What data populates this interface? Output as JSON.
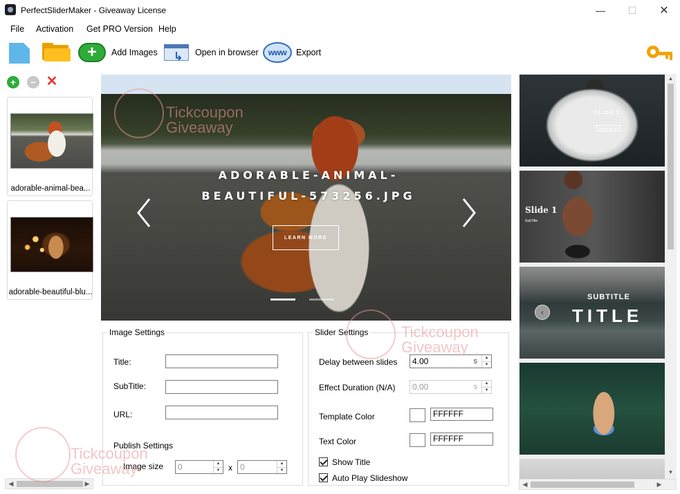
{
  "window": {
    "title": "PerfectSliderMaker - Giveaway License",
    "controls": {
      "minimize": "—",
      "maximize": "☐",
      "close": "✕"
    }
  },
  "menu": [
    {
      "label": "File"
    },
    {
      "label": "Activation"
    },
    {
      "label": "Get PRO Version"
    },
    {
      "label": "Help"
    }
  ],
  "toolbar": {
    "new_icon": "new-file-icon",
    "open_icon": "open-folder-icon",
    "add_images_label": "Add Images",
    "open_browser_label": "Open in browser",
    "export_label": "Export",
    "www_text": "www",
    "key_icon": "key-icon"
  },
  "image_list": {
    "add": "+",
    "remove": "−",
    "delete": "✕",
    "items": [
      {
        "caption": "adorable-animal-bea..."
      },
      {
        "caption": "adorable-beautiful-blu..."
      }
    ]
  },
  "preview": {
    "slide_title": "ADORABLE-ANIMAL-BEAUTIFUL-573256.JPG",
    "button_label": "LEARN MORE"
  },
  "image_settings": {
    "group_title": "Image Settings",
    "title_label": "Title:",
    "title_value": "",
    "subtitle_label": "SubTitle:",
    "subtitle_value": "",
    "url_label": "URL:",
    "url_value": "",
    "publish_label": "Publish Settings",
    "image_size_label": "Image size",
    "width_value": "0",
    "height_value": "0",
    "x_sep": "x"
  },
  "slider_settings": {
    "group_title": "Slider Settings",
    "delay_label": "Delay between slides",
    "delay_value": "4.00",
    "delay_unit": "s",
    "effect_label": "Effect Duration (N/A)",
    "effect_value": "0.00",
    "effect_unit": "s",
    "template_color_label": "Template Color",
    "template_color_value": "FFFFFF",
    "text_color_label": "Text Color",
    "text_color_value": "FFFFFF",
    "show_title_label": "Show Title",
    "show_title_checked": true,
    "autoplay_label": "Auto Play Slideshow",
    "autoplay_checked": true
  },
  "templates": [
    {
      "title": "SLIDE 1",
      "button": "LEARN MORE"
    },
    {
      "title": "Slide 1",
      "subtitle": "SubTitle"
    },
    {
      "subtitle": "SUBTITLE",
      "title": "TITLE"
    },
    {},
    {}
  ],
  "watermark": {
    "line1": "Tickcoupon",
    "line2": "Giveaway"
  }
}
